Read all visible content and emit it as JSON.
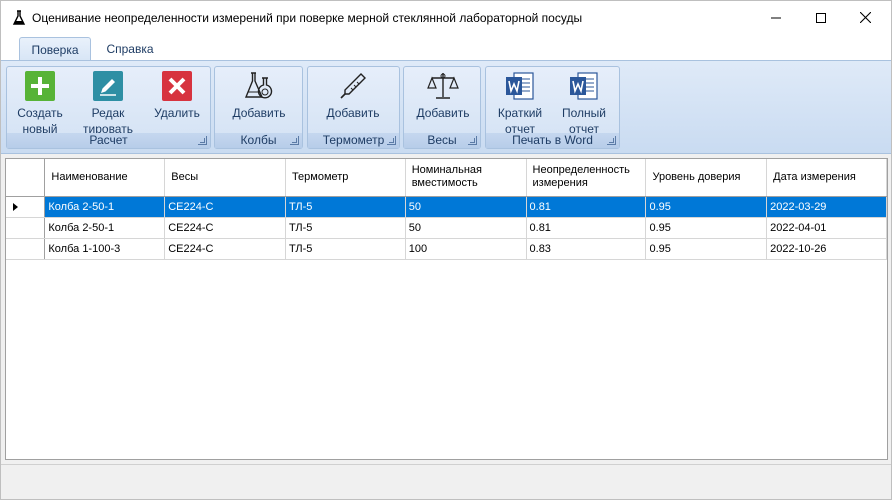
{
  "window": {
    "title": "Оценивание неопределенности измерений при поверке мерной стеклянной лабораторной посуды"
  },
  "tabs": [
    {
      "label": "Поверка",
      "active": true
    },
    {
      "label": "Справка",
      "active": false
    }
  ],
  "ribbon": {
    "groups": {
      "raschet": {
        "caption": "Расчет",
        "buttons": [
          {
            "line1": "Создать",
            "line2": "новый",
            "icon": "plus-icon",
            "color": "#57b337"
          },
          {
            "line1": "Редак",
            "line2": "тировать",
            "icon": "pencil-icon",
            "color": "#2e8fa4"
          },
          {
            "line1": "Удалить",
            "line2": "",
            "icon": "delete-x-icon",
            "color": "#d7333f"
          }
        ]
      },
      "kolby": {
        "caption": "Колбы",
        "buttons": [
          {
            "line1": "Добавить",
            "icon": "flasks-icon"
          }
        ]
      },
      "termometr": {
        "caption": "Термометр",
        "buttons": [
          {
            "line1": "Добавить",
            "icon": "thermometer-icon"
          }
        ]
      },
      "vesy": {
        "caption": "Весы",
        "buttons": [
          {
            "line1": "Добавить",
            "icon": "scales-icon"
          }
        ]
      },
      "print": {
        "caption": "Печать в Word",
        "buttons": [
          {
            "line1": "Краткий",
            "line2": "отчет",
            "icon": "word-icon",
            "color": "#2b579a"
          },
          {
            "line1": "Полный",
            "line2": "отчет",
            "icon": "word-icon",
            "color": "#2b579a"
          }
        ]
      }
    }
  },
  "grid": {
    "columns": [
      "Наименование",
      "Весы",
      "Термометр",
      "Номинальная вместимость",
      "Неопределенность измерения",
      "Уровень доверия",
      "Дата измерения"
    ],
    "rows": [
      [
        "Колба 2-50-1",
        "CE224-C",
        "ТЛ-5",
        "50",
        "0.81",
        "0.95",
        "2022-03-29"
      ],
      [
        "Колба 2-50-1",
        "CE224-C",
        "ТЛ-5",
        "50",
        "0.81",
        "0.95",
        "2022-04-01"
      ],
      [
        "Колба 1-100-3",
        "CE224-C",
        "ТЛ-5",
        "100",
        "0.83",
        "0.95",
        "2022-10-26"
      ]
    ],
    "selected_row": 0,
    "selection_color": "#0078d7"
  }
}
